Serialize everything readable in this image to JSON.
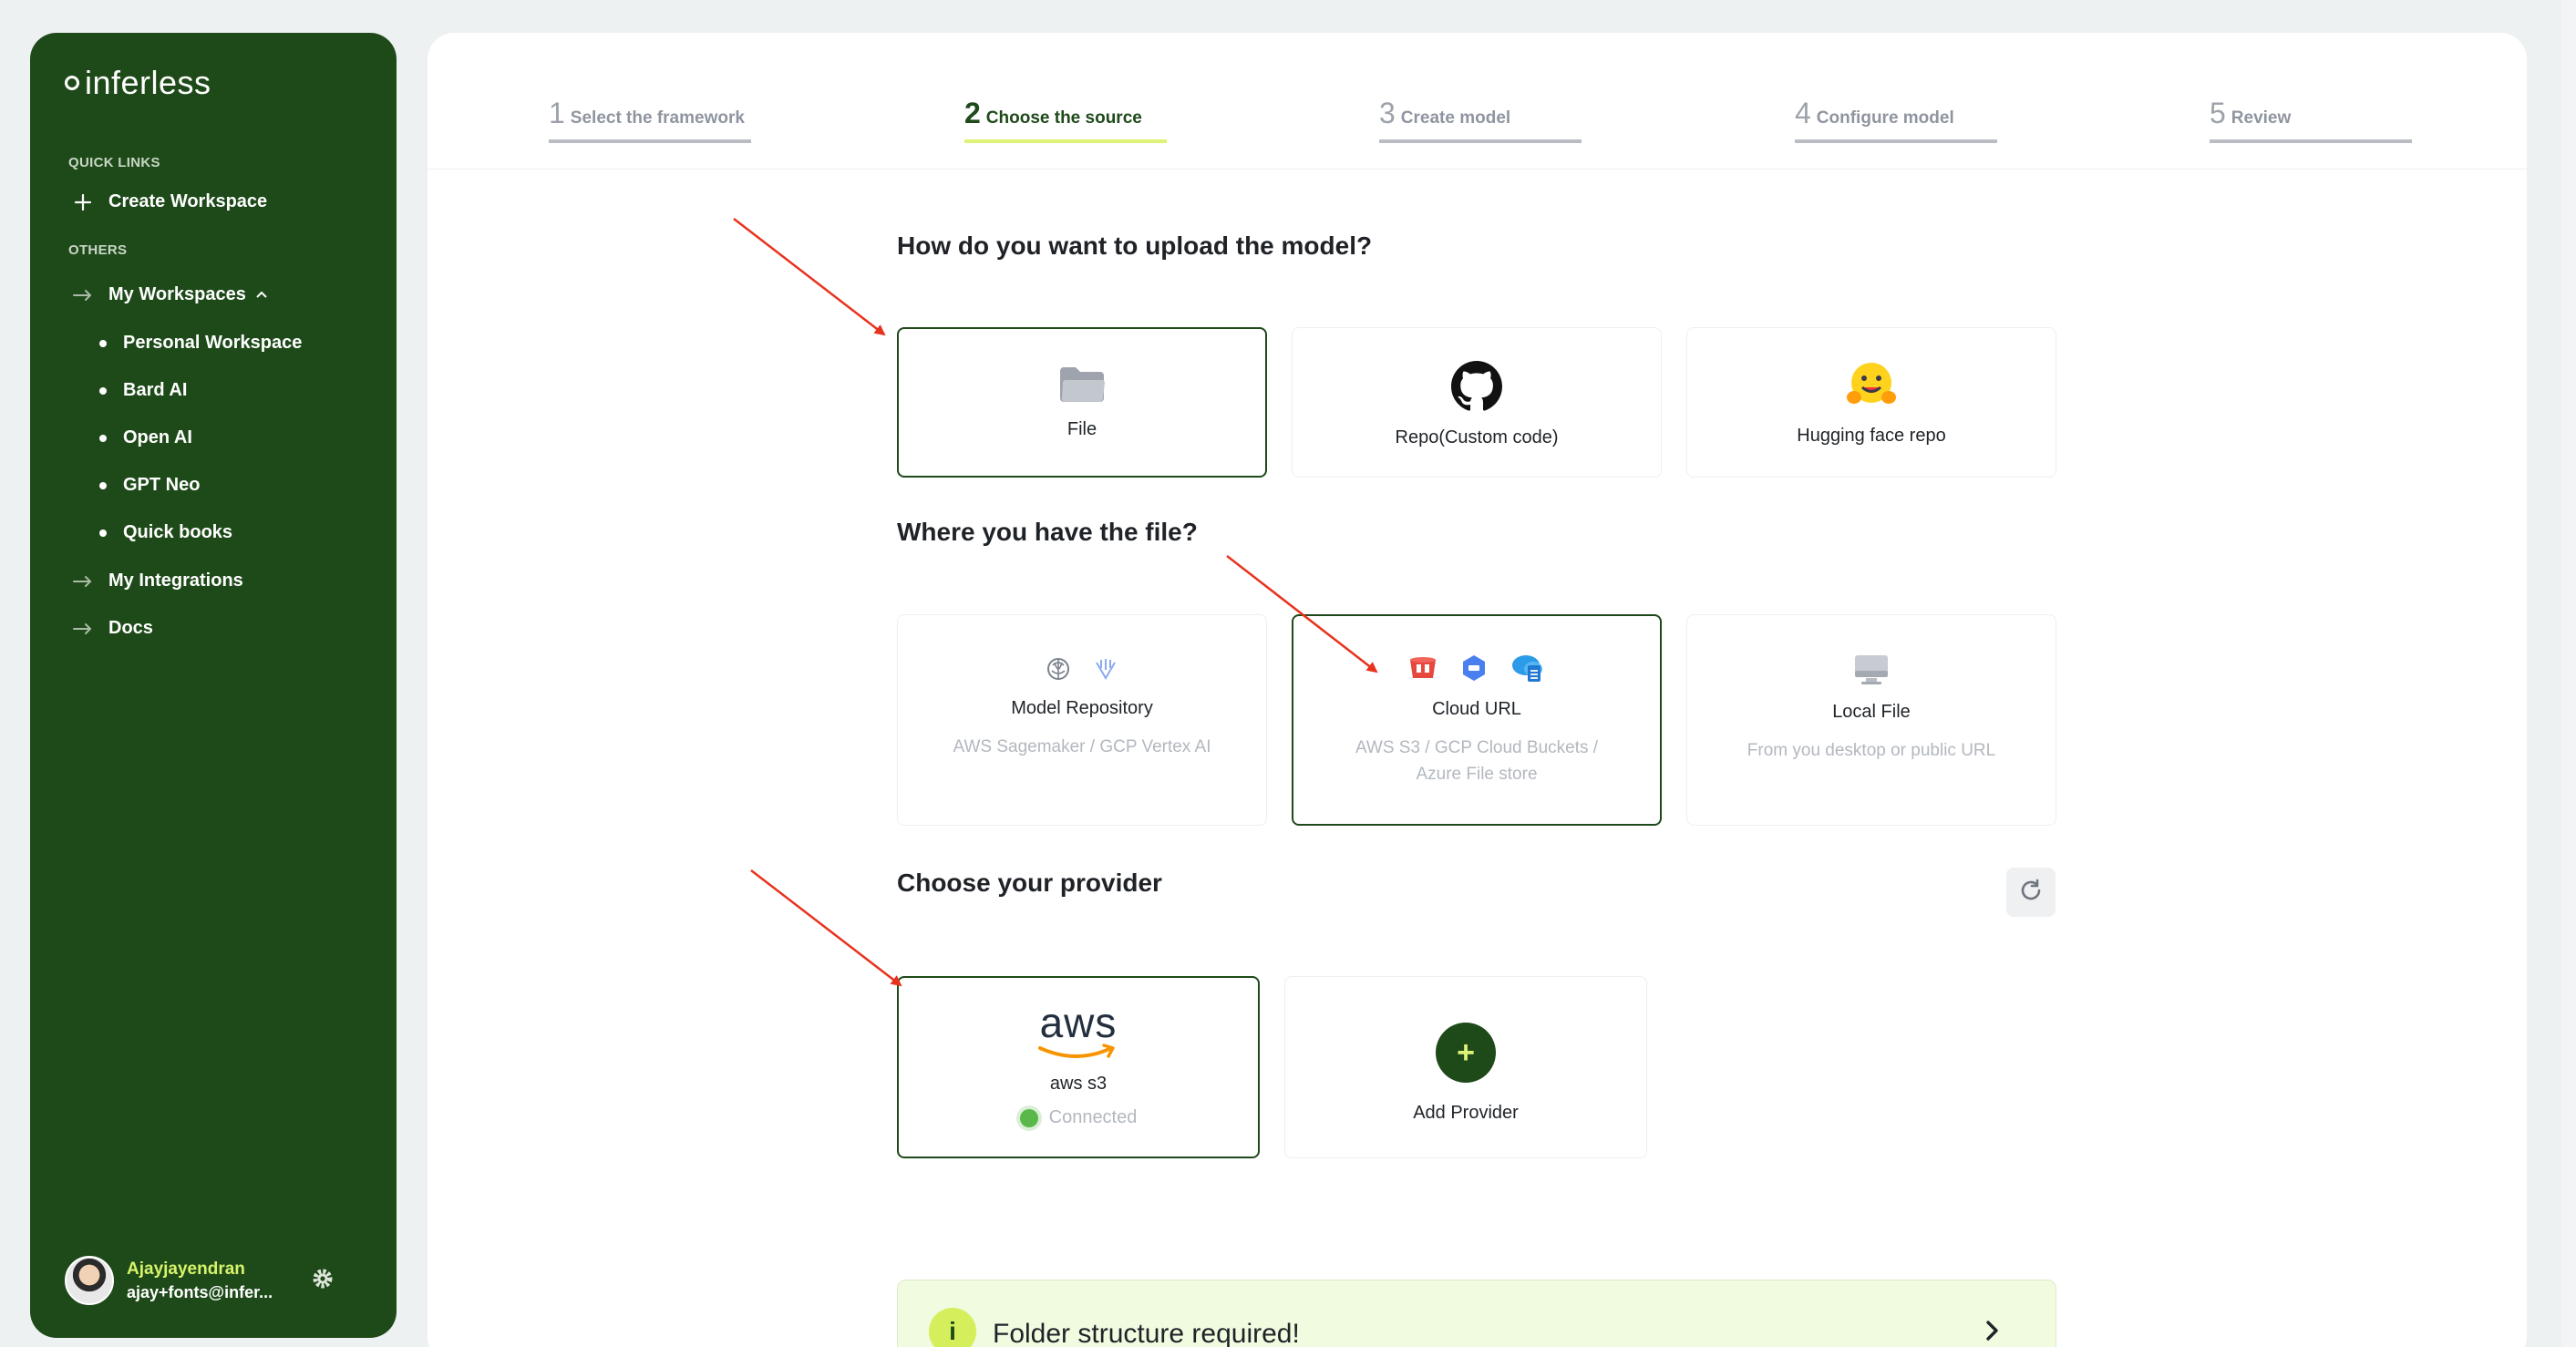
{
  "sidebar": {
    "logo": "inferless",
    "quick_links_label": "QUICK LINKS",
    "create_workspace": "Create Workspace",
    "others_label": "OTHERS",
    "my_workspaces": "My Workspaces",
    "workspaces": [
      "Personal Workspace",
      "Bard AI",
      "Open AI",
      "GPT Neo",
      "Quick books"
    ],
    "my_integrations": "My Integrations",
    "docs": "Docs",
    "user": {
      "name": "Ajayjayendran",
      "email": "ajay+fonts@infer..."
    }
  },
  "stepper": {
    "steps": [
      {
        "num": "1",
        "label": "Select the framework"
      },
      {
        "num": "2",
        "label": "Choose the source"
      },
      {
        "num": "3",
        "label": "Create model"
      },
      {
        "num": "4",
        "label": "Configure model"
      },
      {
        "num": "5",
        "label": "Review"
      }
    ],
    "active_index": 1
  },
  "upload": {
    "heading": "How do you want to upload the model?",
    "options": [
      {
        "title": "File",
        "icon": "folder-icon",
        "selected": true
      },
      {
        "title": "Repo(Custom code)",
        "icon": "github-icon",
        "selected": false
      },
      {
        "title": "Hugging face repo",
        "icon": "hugging-face-icon",
        "selected": false
      }
    ]
  },
  "location": {
    "heading": "Where you have the file?",
    "options": [
      {
        "title": "Model Repository",
        "subtitle": "AWS Sagemaker / GCP Vertex AI",
        "selected": false
      },
      {
        "title": "Cloud URL",
        "subtitle_line1": "AWS S3 / GCP Cloud Buckets /",
        "subtitle_line2": "Azure File store",
        "selected": true
      },
      {
        "title": "Local File",
        "subtitle": "From you desktop or public URL",
        "selected": false
      }
    ]
  },
  "provider": {
    "heading": "Choose your provider",
    "providers": [
      {
        "logo_text": "aws",
        "name": "aws s3",
        "status": "Connected",
        "selected": true
      }
    ],
    "add_label": "Add Provider",
    "add_symbol": "+"
  },
  "banner": {
    "icon_text": "i",
    "text": "Folder structure required!"
  },
  "colors": {
    "brand": "#1e4a19",
    "accent": "#dff176",
    "arrow": "#e8321d"
  }
}
